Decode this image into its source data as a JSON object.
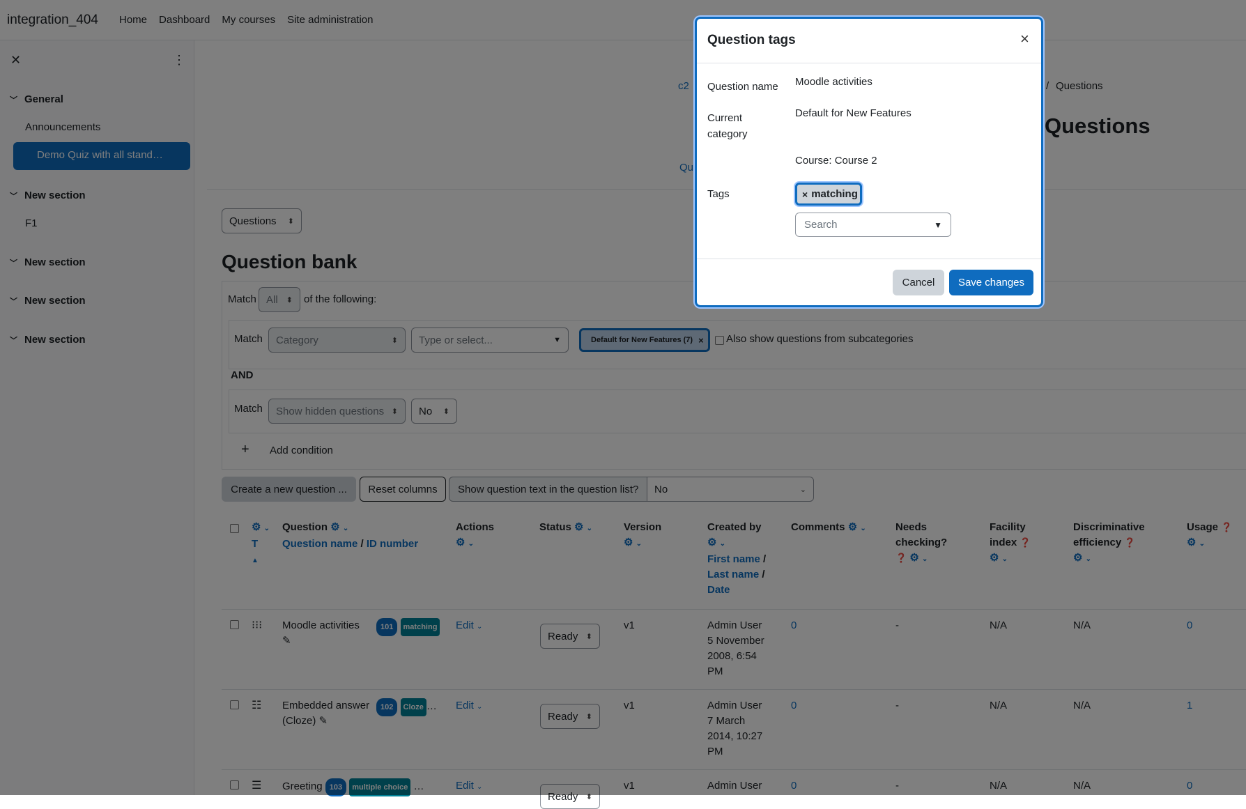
{
  "navbar": {
    "site_name": "integration_404",
    "links": [
      "Home",
      "Dashboard",
      "My courses",
      "Site administration"
    ]
  },
  "drawer": {
    "sections": [
      {
        "title": "General",
        "items": [
          "Announcements",
          "Demo Quiz with all stand…"
        ]
      },
      {
        "title": "New section",
        "items": [
          "F1"
        ]
      },
      {
        "title": "New section",
        "items": []
      },
      {
        "title": "New section",
        "items": []
      },
      {
        "title": "New section",
        "items": []
      }
    ]
  },
  "header": {
    "breadcrumb_start": "c2",
    "breadcrumb_sep": "/",
    "breadcrumb_end": "Questions",
    "page_title": "Questions",
    "tab_partial": "Qu"
  },
  "bank": {
    "nav_select": "Questions",
    "title": "Question bank",
    "match_label": "Match",
    "match_value": "All",
    "of_following": "of the following:",
    "cond1": {
      "match": "Match",
      "field": "Category",
      "type_placeholder": "Type or select...",
      "chip": "Default for New Features (7)",
      "subcat_label": "Also show questions from subcategories"
    },
    "and_label": "AND",
    "cond2": {
      "match": "Match",
      "field": "Show hidden questions",
      "value": "No"
    },
    "add_condition": "Add condition",
    "create_button": "Create a new question ...",
    "reset_button": "Reset columns",
    "show_text_label": "Show question text in the question list?",
    "show_text_value": "No"
  },
  "table": {
    "headers": {
      "t": "T",
      "question": "Question",
      "question_name": "Question name",
      "slash": "/",
      "id_number": "ID number",
      "actions": "Actions",
      "status": "Status",
      "version": "Version",
      "created_by": "Created by",
      "first_name": "First name",
      "last_name": "Last name",
      "date": "Date",
      "comments": "Comments",
      "needs": "Needs",
      "checking": "checking?",
      "facility": "Facility",
      "index": "index",
      "discriminative": "Discriminative",
      "efficiency": "efficiency",
      "usage": "Usage"
    },
    "rows": [
      {
        "name": "Moodle activities",
        "name2": "",
        "id": "101",
        "tag": "matching",
        "action": "Edit",
        "status": "Ready",
        "version": "v1",
        "user": "Admin User",
        "date1": "5 November",
        "date2": "2008, 6:54",
        "date3": "PM",
        "comments": "0",
        "needs": "-",
        "facility": "N/A",
        "disc": "N/A",
        "usage": "0"
      },
      {
        "name": "Embedded answer",
        "name2": "(Cloze)",
        "id": "102",
        "tag": "Cloze",
        "action": "Edit",
        "status": "Ready",
        "version": "v1",
        "user": "Admin User",
        "date1": "7 March",
        "date2": "2014, 10:27",
        "date3": "PM",
        "comments": "0",
        "needs": "-",
        "facility": "N/A",
        "disc": "N/A",
        "usage": "1"
      },
      {
        "name": "Greeting",
        "name2": "",
        "id": "103",
        "tag": "multiple choice",
        "action": "Edit",
        "status": "Ready",
        "version": "v1",
        "user": "Admin User",
        "date1": "",
        "date2": "",
        "date3": "",
        "comments": "0",
        "needs": "-",
        "facility": "N/A",
        "disc": "N/A",
        "usage": "0"
      }
    ]
  },
  "modal": {
    "title": "Question tags",
    "close": "×",
    "name_label": "Question name",
    "name_value": "Moodle activities",
    "category_label_1": "Current",
    "category_label_2": "category",
    "category_value": "Default for New Features",
    "course_value": "Course: Course 2",
    "tags_label": "Tags",
    "tag_chip": "matching",
    "search_placeholder": "Search",
    "cancel": "Cancel",
    "save": "Save changes"
  },
  "colors": {
    "primary": "#0f6cbf",
    "tag": "#008196",
    "overlay": "rgba(0,0,0,0.5)"
  }
}
